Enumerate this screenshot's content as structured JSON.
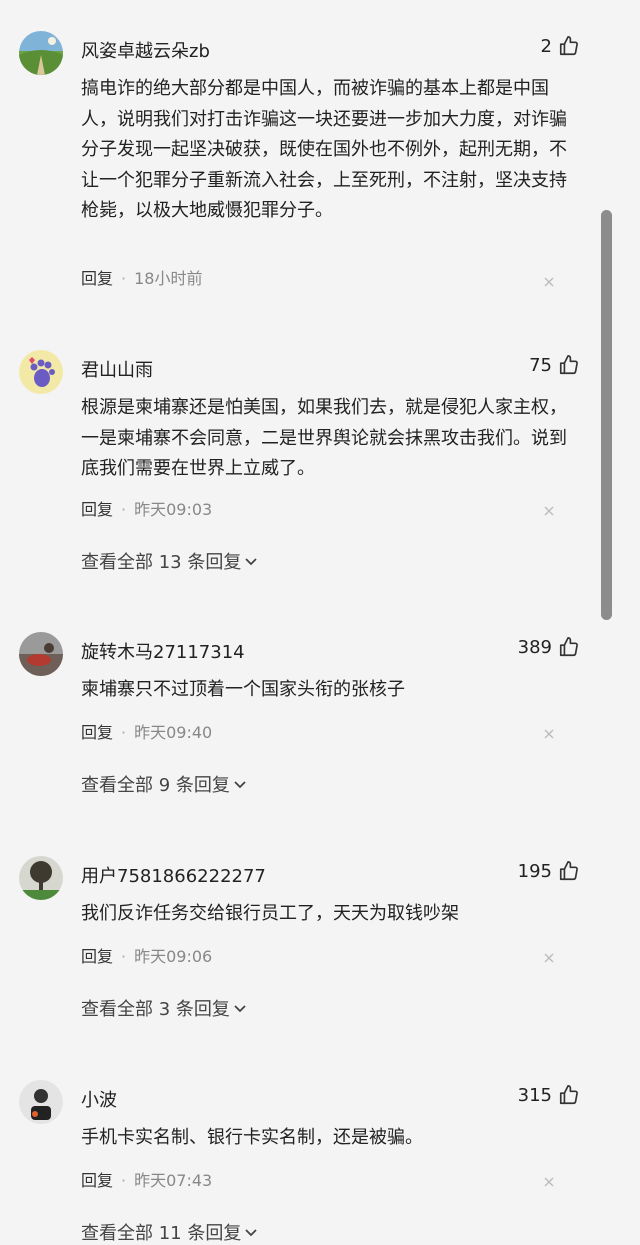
{
  "comments": [
    {
      "username": "风姿卓越云朵zb",
      "likes": "2",
      "content": "搞电诈的绝大部分都是中国人，而被诈骗的基本上都是中国人，说明我们对打击诈骗这一块还要进一步加大力度，对诈骗分子发现一起坚决破获，既使在国外也不例外，起刑无期，不让一个犯罪分子重新流入社会，上至死刑，不注射，坚决支持枪毙，以极大地威慑犯罪分子。",
      "reply_label": "回复",
      "time": "18小时前",
      "avatar_icon": "landscape-avatar-icon"
    },
    {
      "username": "君山山雨",
      "likes": "75",
      "content": "根源是柬埔寨还是怕美国，如果我们去，就是侵犯人家主权，一是柬埔寨不会同意，二是世界舆论就会抹黑攻击我们。说到底我们需要在世界上立威了。",
      "reply_label": "回复",
      "time": "昨天09:03",
      "view_replies": "查看全部 13 条回复",
      "avatar_icon": "paw-avatar-icon"
    },
    {
      "username": "旋转木马27117314",
      "likes": "389",
      "content": "柬埔寨只不过顶着一个国家头衔的张核子",
      "reply_label": "回复",
      "time": "昨天09:40",
      "view_replies": "查看全部 9 条回复",
      "avatar_icon": "photo-avatar-icon"
    },
    {
      "username": "用户7581866222277",
      "likes": "195",
      "content": "我们反诈任务交给银行员工了，天天为取钱吵架",
      "reply_label": "回复",
      "time": "昨天09:06",
      "view_replies": "查看全部 3 条回复",
      "avatar_icon": "tree-avatar-icon"
    },
    {
      "username": "小波",
      "likes": "315",
      "content": "手机卡实名制、银行卡实名制，还是被骗。",
      "reply_label": "回复",
      "time": "昨天07:43",
      "view_replies": "查看全部 11 条回复",
      "avatar_icon": "figure-avatar-icon"
    }
  ],
  "icons": {
    "like": "thumbs-up-icon",
    "close": "close-icon",
    "expand": "chevron-down-icon"
  },
  "colors": {
    "background": "#f4f4f4",
    "text": "#222222",
    "meta": "#888888",
    "scrollbar": "#8c8c8c"
  }
}
